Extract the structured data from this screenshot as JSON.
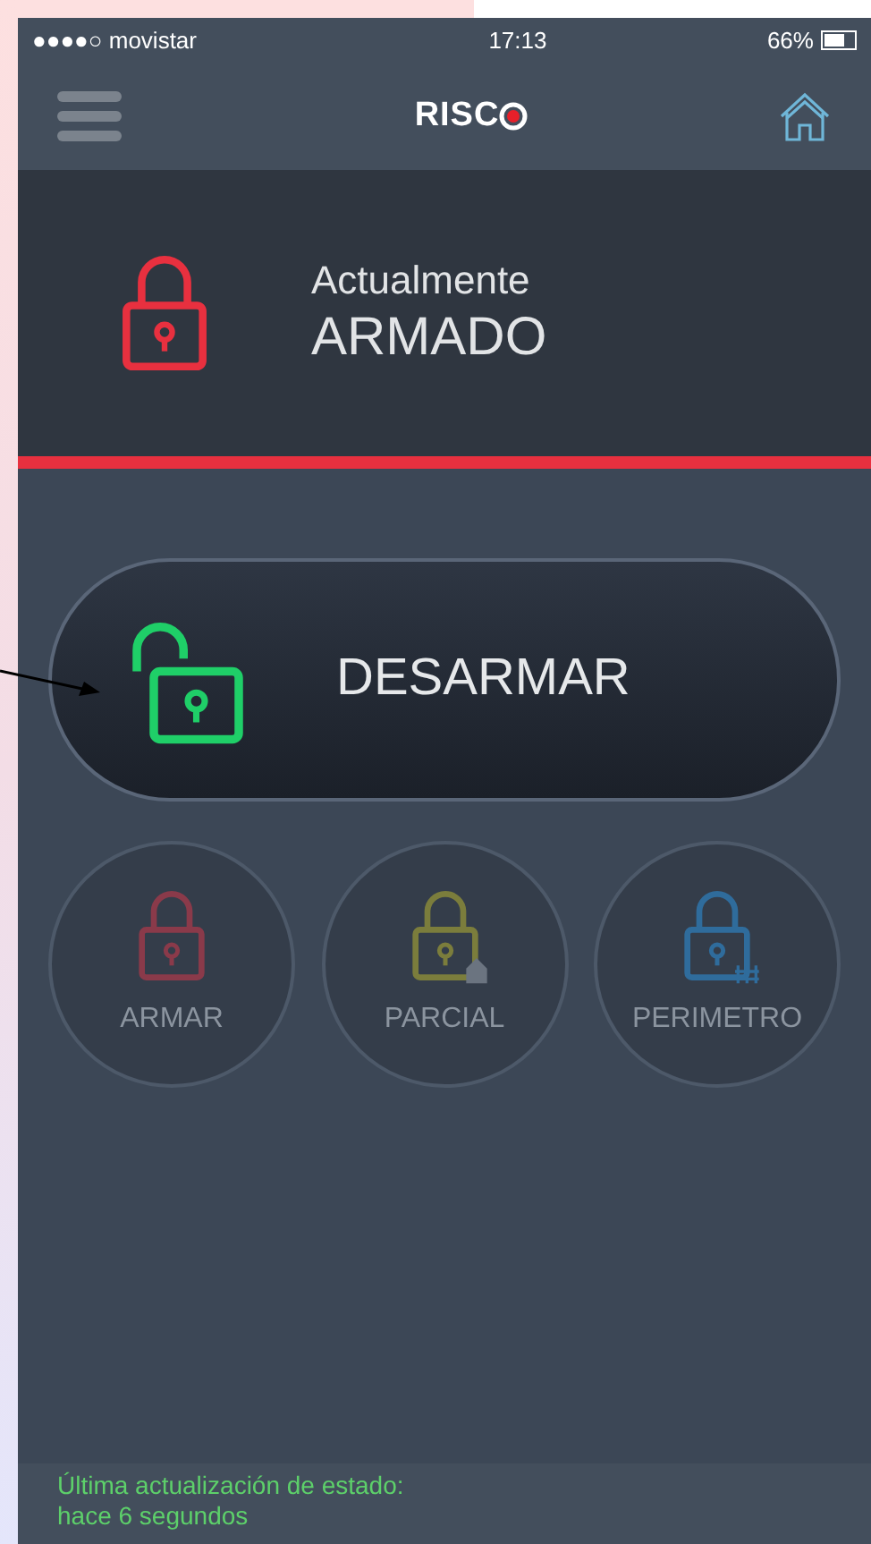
{
  "status_bar": {
    "carrier": "●●●●○ movistar",
    "time": "17:13",
    "battery": "66%"
  },
  "header": {
    "logo": "RISC"
  },
  "status_panel": {
    "label": "Actualmente",
    "state": "ARMADO",
    "color": "#e8303f"
  },
  "main_action": {
    "label": "DESARMAR",
    "color": "#1fcf68"
  },
  "modes": [
    {
      "kind": "arm",
      "label": "ARMAR",
      "color": "#8a3a4a",
      "disabled": true
    },
    {
      "kind": "partial",
      "label": "PARCIAL",
      "color": "#7b7d3c",
      "disabled": true
    },
    {
      "kind": "perimeter",
      "label": "PERIMETRO",
      "color": "#2f6c9c",
      "disabled": true
    }
  ],
  "footer": {
    "lines": [
      "Última actualización de estado:",
      "hace 6 segundos"
    ]
  }
}
